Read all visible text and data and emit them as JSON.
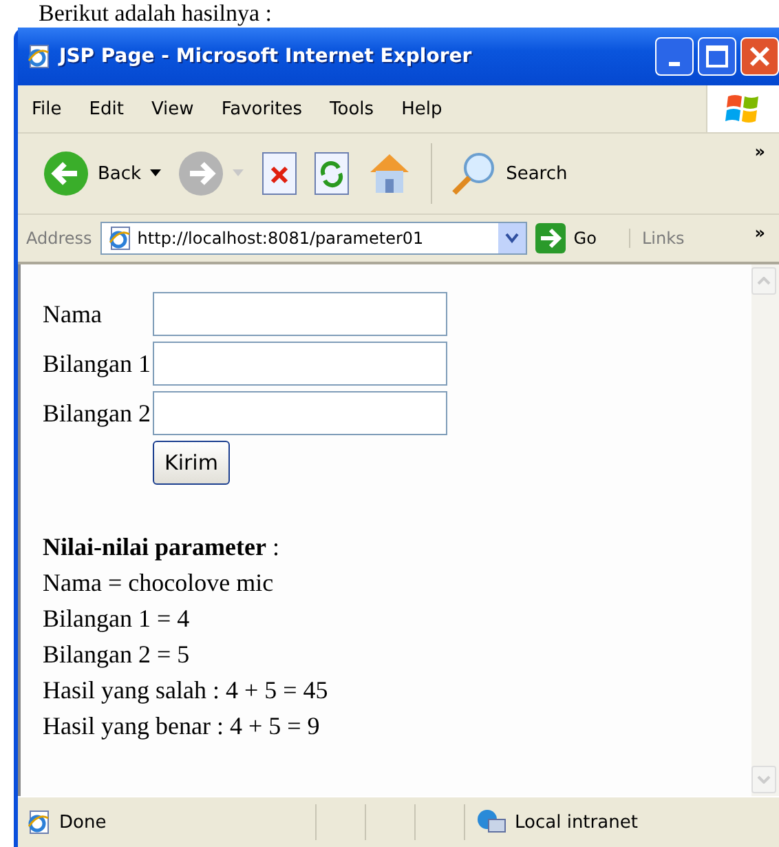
{
  "caption": "Berikut adalah hasilnya :",
  "window": {
    "title": "JSP Page - Microsoft Internet Explorer"
  },
  "menu": [
    "File",
    "Edit",
    "View",
    "Favorites",
    "Tools",
    "Help"
  ],
  "toolbar": {
    "back": "Back",
    "search": "Search",
    "more": "»"
  },
  "address_bar": {
    "label": "Address",
    "url": "http://localhost:8081/parameter01",
    "go": "Go",
    "links": "Links",
    "more": "»"
  },
  "form": {
    "fields": [
      {
        "label": "Nama"
      },
      {
        "label": "Bilangan 1"
      },
      {
        "label": "Bilangan 2"
      }
    ],
    "submit": "Kirim"
  },
  "results": {
    "heading": "**Nilai-nilai parameter** :",
    "lines": [
      "Nama = chocolove mic",
      "Bilangan 1 = 4",
      "Bilangan 2 = 5",
      "Hasil yang salah : 4 + 5 = 45",
      "Hasil yang benar : 4 + 5 = 9"
    ]
  },
  "status_bar": {
    "status": "Done",
    "zone": "Local intranet"
  }
}
